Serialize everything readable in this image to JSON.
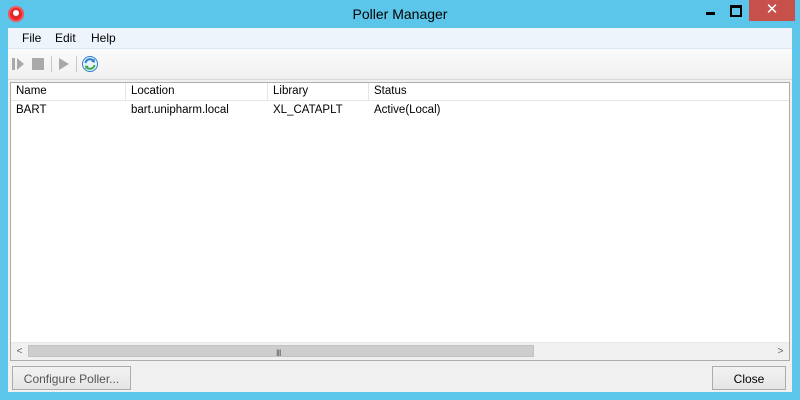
{
  "window": {
    "title": "Poller Manager",
    "close_glyph": "✕"
  },
  "menu": {
    "items": [
      "File",
      "Edit",
      "Help"
    ]
  },
  "toolbar": {
    "icons": [
      "pause-icon",
      "stop-icon",
      "play-icon",
      "refresh-icon"
    ]
  },
  "list": {
    "columns": [
      "Name",
      "Location",
      "Library",
      "Status"
    ],
    "rows": [
      {
        "name": "BART",
        "location": "bart.unipharm.local",
        "library": "XL_CATAPLT",
        "status": "Active(Local)"
      }
    ]
  },
  "scrollbar": {
    "left_arrow": "<",
    "right_arrow": ">",
    "grip": "III"
  },
  "buttons": {
    "configure_label": "Configure Poller...",
    "close_label": "Close"
  },
  "colors": {
    "titlebar": "#5cc6ea",
    "close_button": "#c7504a"
  }
}
